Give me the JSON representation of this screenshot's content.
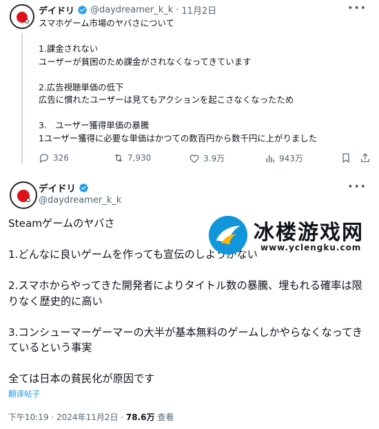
{
  "tweet1": {
    "name": "デイドリ",
    "handle": "@daydreamer_k_k",
    "separator": "·",
    "date": "11月2日",
    "more_icon": "more-horizontal-icon",
    "text": "スマホゲーム市場のヤバさについて\n\n1.課金されない\nユーザーが貧困のため課金がされなくなってきています\n\n2.広告視聴単価の低下\n広告に慣れたユーザーは見てもアクションを起こさなくなったため\n\n3.　ユーザー獲得単価の暴騰\n1ユーザー獲得に必要な単価はかつての数百円から数千円に上がりました",
    "actions": {
      "reply_count": "326",
      "retweet_count": "7,930",
      "like_count": "3.9万",
      "view_count": "943万"
    }
  },
  "tweet2": {
    "name": "デイドリ",
    "handle": "@daydreamer_k_k",
    "text": "Steamゲームのヤバさ\n\n1.どんなに良いゲームを作っても宣伝のしようがない\n\n2.スマホからやってきた開発者によりタイトル数の暴騰、埋もれる確率は限りなく歴史的に高い\n\n3.コンシューマーゲーマーの大半が基本無料のゲームしかやらなくなってきているという事実\n\n全ては日本の貧民化が原因です",
    "translate_label": "翻译帖子",
    "timestamp": "下午10:19 · 2024年11月2日 · ",
    "views": "78.6万",
    "views_label": " 查看"
  },
  "watermark": {
    "title": "冰楼游戏网",
    "url": "www.yclengku.com"
  },
  "colors": {
    "accent": "#1d9bf0",
    "secondary_text": "#536471",
    "avatar_red": "#e0101a"
  }
}
